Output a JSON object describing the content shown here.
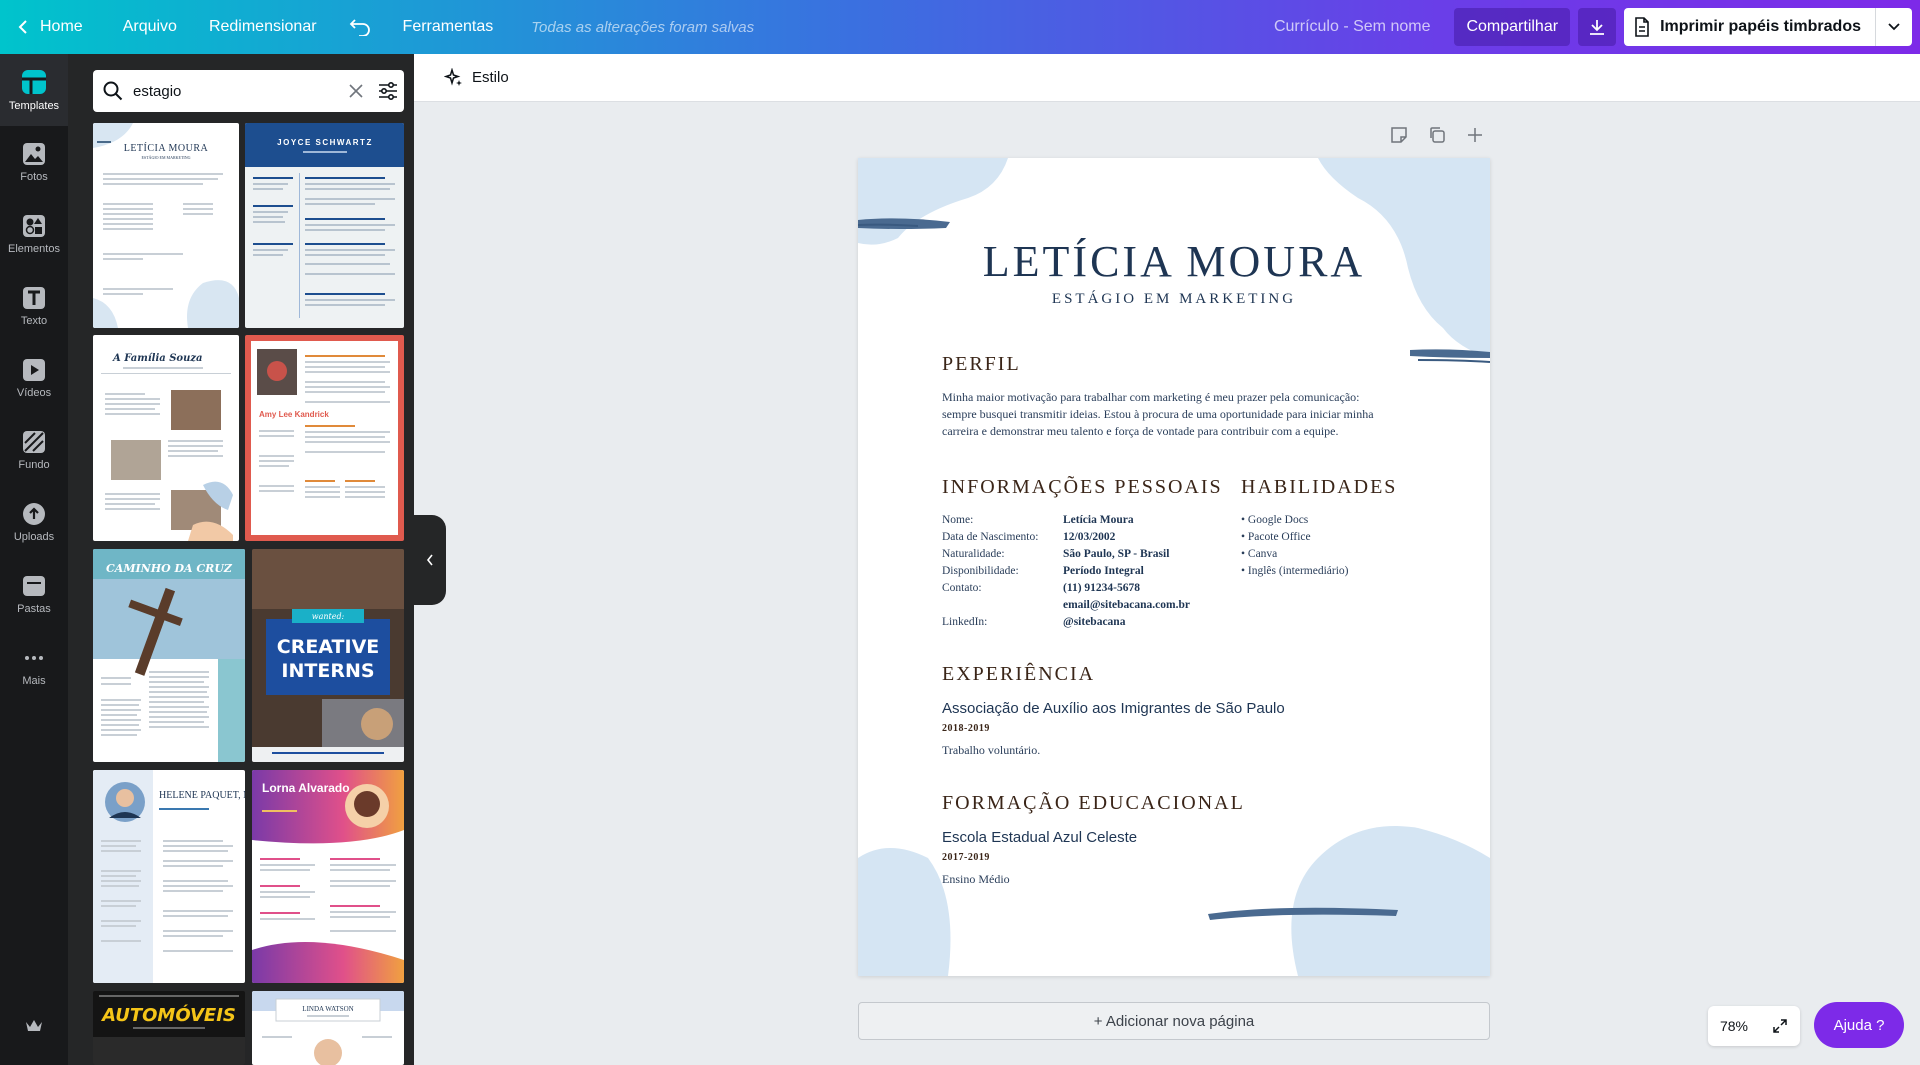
{
  "topbar": {
    "home": "Home",
    "file": "Arquivo",
    "resize": "Redimensionar",
    "tools": "Ferramentas",
    "save_status": "Todas as alterações foram salvas",
    "doc_name": "Currículo - Sem nome",
    "share": "Compartilhar",
    "print": "Imprimir papéis timbrados"
  },
  "rail": [
    {
      "label": "Templates",
      "icon": "templates-icon"
    },
    {
      "label": "Fotos",
      "icon": "photos-icon"
    },
    {
      "label": "Elementos",
      "icon": "elements-icon"
    },
    {
      "label": "Texto",
      "icon": "text-icon"
    },
    {
      "label": "Vídeos",
      "icon": "videos-icon"
    },
    {
      "label": "Fundo",
      "icon": "background-icon"
    },
    {
      "label": "Uploads",
      "icon": "uploads-icon"
    },
    {
      "label": "Pastas",
      "icon": "folders-icon"
    },
    {
      "label": "Mais",
      "icon": "more-icon"
    }
  ],
  "search": {
    "value": "estagio"
  },
  "thumbs": {
    "t1_name": "LETÍCIA MOURA",
    "t1_sub": "ESTÁGIO EM MARKETING",
    "t2_name": "JOYCE SCHWARTZ",
    "t3_title": "A Família Souza",
    "t4_name": "Amy Lee Kandrick",
    "t5_title": "CAMINHO DA CRUZ",
    "t6_l1": "CREATIVE",
    "t6_l2": "INTERNS",
    "t6_tag": "wanted:",
    "t7_name": "HELENE PAQUET, MD",
    "t8_name": "Lorna Alvarado",
    "t9_title": "AUTOMÓVEIS",
    "t10_name": "LINDA WATSON"
  },
  "canvas": {
    "style_label": "Estilo",
    "add_page": "+ Adicionar nova página",
    "zoom": "78%",
    "help": "Ajuda ?"
  },
  "resume": {
    "name": "LETÍCIA MOURA",
    "role": "ESTÁGIO EM MARKETING",
    "profile_h": "PERFIL",
    "profile_lines": [
      "Minha maior motivação para trabalhar com marketing é meu prazer pela comunicação:",
      "sempre busquei transmitir ideias. Estou à procura de uma oportunidade para iniciar minha",
      "carreira e demonstrar meu talento e força de vontade para contribuir com a equipe."
    ],
    "info_h": "INFORMAÇÕES PESSOAIS",
    "info": [
      {
        "label": "Nome:",
        "value": "Letícia Moura"
      },
      {
        "label": "Data de Nascimento:",
        "value": "12/03/2002"
      },
      {
        "label": "Naturalidade:",
        "value": "São Paulo, SP - Brasil"
      },
      {
        "label": "Disponibilidade:",
        "value": "Período Integral"
      },
      {
        "label": "Contato:",
        "value": "(11) 91234-5678"
      },
      {
        "label": "",
        "value": "email@sitebacana.com.br"
      },
      {
        "label": "LinkedIn:",
        "value": "@sitebacana"
      }
    ],
    "skills_h": "HABILIDADES",
    "skills": [
      "Google Docs",
      "Pacote Office",
      "Canva",
      "Inglês (intermediário)"
    ],
    "exp_h": "EXPERIÊNCIA",
    "exp_org": "Associação de Auxílio aos Imigrantes de São Paulo",
    "exp_year": "2018-2019",
    "exp_desc": "Trabalho voluntário.",
    "edu_h": "FORMAÇÃO EDUCACIONAL",
    "edu_org": "Escola Estadual Azul Celeste",
    "edu_year": "2017-2019",
    "edu_desc": "Ensino Médio"
  }
}
